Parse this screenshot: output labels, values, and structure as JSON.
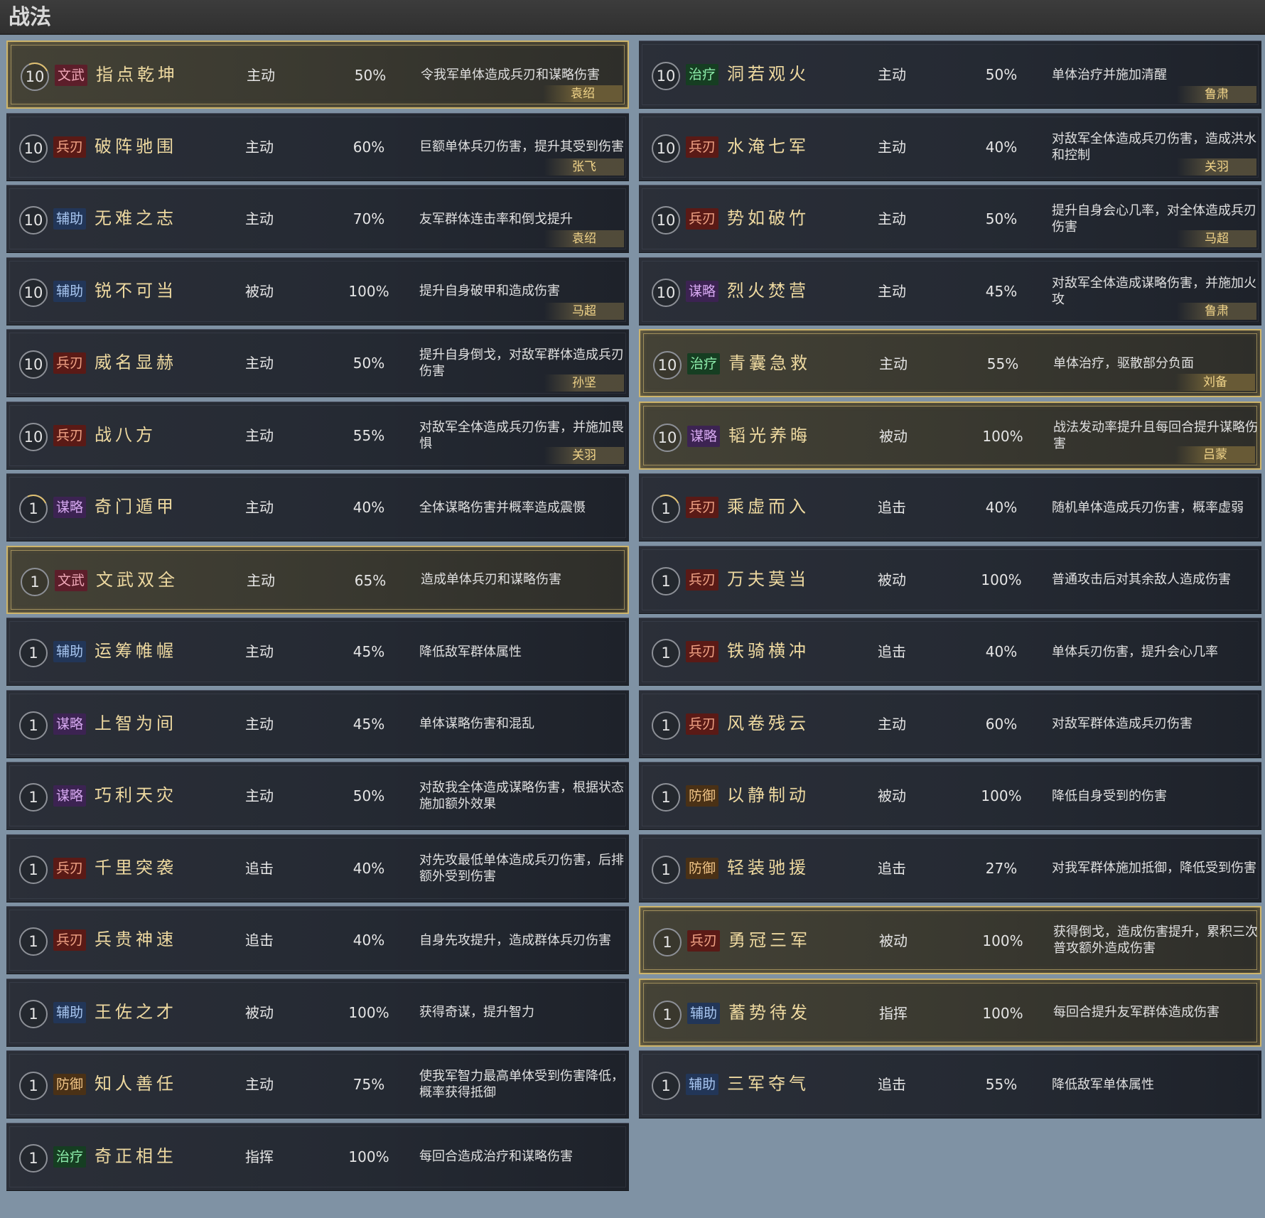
{
  "title": "战法",
  "columns": [
    [
      {
        "level": "10",
        "arc": true,
        "tag": "文武",
        "tag_class": "wenwu",
        "name": "指点乾坤",
        "type": "主动",
        "rate": "50%",
        "desc": "令我军单体造成兵刃和谋略伤害",
        "general": "袁绍",
        "highlight": true
      },
      {
        "level": "10",
        "arc": false,
        "tag": "兵刃",
        "tag_class": "bingren",
        "name": "破阵驰围",
        "type": "主动",
        "rate": "60%",
        "desc": "巨额单体兵刃伤害，提升其受到伤害",
        "general": "张飞",
        "highlight": false
      },
      {
        "level": "10",
        "arc": false,
        "tag": "辅助",
        "tag_class": "fuzhu",
        "name": "无难之志",
        "type": "主动",
        "rate": "70%",
        "desc": "友军群体连击率和倒戈提升",
        "general": "袁绍",
        "highlight": false
      },
      {
        "level": "10",
        "arc": false,
        "tag": "辅助",
        "tag_class": "fuzhu",
        "name": "锐不可当",
        "type": "被动",
        "rate": "100%",
        "desc": "提升自身破甲和造成伤害",
        "general": "马超",
        "highlight": false
      },
      {
        "level": "10",
        "arc": false,
        "tag": "兵刃",
        "tag_class": "bingren",
        "name": "威名显赫",
        "type": "主动",
        "rate": "50%",
        "desc": "提升自身倒戈，对敌军群体造成兵刃伤害",
        "general": "孙坚",
        "highlight": false
      },
      {
        "level": "10",
        "arc": false,
        "tag": "兵刃",
        "tag_class": "bingren",
        "name": "战八方",
        "type": "主动",
        "rate": "55%",
        "desc": "对敌军全体造成兵刃伤害，并施加畏惧",
        "general": "关羽",
        "highlight": false
      },
      {
        "level": "1",
        "arc": true,
        "tag": "谋略",
        "tag_class": "moulue",
        "name": "奇门遁甲",
        "type": "主动",
        "rate": "40%",
        "desc": "全体谋略伤害并概率造成震慑",
        "general": "",
        "highlight": false
      },
      {
        "level": "1",
        "arc": false,
        "tag": "文武",
        "tag_class": "wenwu",
        "name": "文武双全",
        "type": "主动",
        "rate": "65%",
        "desc": "造成单体兵刃和谋略伤害",
        "general": "",
        "highlight": true
      },
      {
        "level": "1",
        "arc": false,
        "tag": "辅助",
        "tag_class": "fuzhu",
        "name": "运筹帷幄",
        "type": "主动",
        "rate": "45%",
        "desc": "降低敌军群体属性",
        "general": "",
        "highlight": false
      },
      {
        "level": "1",
        "arc": false,
        "tag": "谋略",
        "tag_class": "moulue",
        "name": "上智为间",
        "type": "主动",
        "rate": "45%",
        "desc": "单体谋略伤害和混乱",
        "general": "",
        "highlight": false
      },
      {
        "level": "1",
        "arc": false,
        "tag": "谋略",
        "tag_class": "moulue",
        "name": "巧利天灾",
        "type": "主动",
        "rate": "50%",
        "desc": "对敌我全体造成谋略伤害，根据状态施加额外效果",
        "general": "",
        "highlight": false
      },
      {
        "level": "1",
        "arc": false,
        "tag": "兵刃",
        "tag_class": "bingren",
        "name": "千里突袭",
        "type": "追击",
        "rate": "40%",
        "desc": "对先攻最低单体造成兵刃伤害，后排额外受到伤害",
        "general": "",
        "highlight": false
      },
      {
        "level": "1",
        "arc": false,
        "tag": "兵刃",
        "tag_class": "bingren",
        "name": "兵贵神速",
        "type": "追击",
        "rate": "40%",
        "desc": "自身先攻提升，造成群体兵刃伤害",
        "general": "",
        "highlight": false
      },
      {
        "level": "1",
        "arc": false,
        "tag": "辅助",
        "tag_class": "fuzhu",
        "name": "王佐之才",
        "type": "被动",
        "rate": "100%",
        "desc": "获得奇谋，提升智力",
        "general": "",
        "highlight": false
      },
      {
        "level": "1",
        "arc": false,
        "tag": "防御",
        "tag_class": "fangyu",
        "name": "知人善任",
        "type": "主动",
        "rate": "75%",
        "desc": "使我军智力最高单体受到伤害降低，概率获得抵御",
        "general": "",
        "highlight": false
      },
      {
        "level": "1",
        "arc": false,
        "tag": "治疗",
        "tag_class": "zhiliao",
        "name": "奇正相生",
        "type": "指挥",
        "rate": "100%",
        "desc": "每回合造成治疗和谋略伤害",
        "general": "",
        "highlight": false
      }
    ],
    [
      {
        "level": "10",
        "arc": false,
        "tag": "治疗",
        "tag_class": "zhiliao",
        "name": "洞若观火",
        "type": "主动",
        "rate": "50%",
        "desc": "单体治疗并施加清醒",
        "general": "鲁肃",
        "highlight": false
      },
      {
        "level": "10",
        "arc": false,
        "tag": "兵刃",
        "tag_class": "bingren",
        "name": "水淹七军",
        "type": "主动",
        "rate": "40%",
        "desc": "对敌军全体造成兵刃伤害，造成洪水和控制",
        "general": "关羽",
        "highlight": false
      },
      {
        "level": "10",
        "arc": false,
        "tag": "兵刃",
        "tag_class": "bingren",
        "name": "势如破竹",
        "type": "主动",
        "rate": "50%",
        "desc": "提升自身会心几率，对全体造成兵刃伤害",
        "general": "马超",
        "highlight": false
      },
      {
        "level": "10",
        "arc": false,
        "tag": "谋略",
        "tag_class": "moulue",
        "name": "烈火焚营",
        "type": "主动",
        "rate": "45%",
        "desc": "对敌军全体造成谋略伤害，并施加火攻",
        "general": "鲁肃",
        "highlight": false
      },
      {
        "level": "10",
        "arc": false,
        "tag": "治疗",
        "tag_class": "zhiliao",
        "name": "青囊急救",
        "type": "主动",
        "rate": "55%",
        "desc": "单体治疗，驱散部分负面",
        "general": "刘备",
        "highlight": true
      },
      {
        "level": "10",
        "arc": false,
        "tag": "谋略",
        "tag_class": "moulue",
        "name": "韬光养晦",
        "type": "被动",
        "rate": "100%",
        "desc": "战法发动率提升且每回合提升谋略伤害",
        "general": "吕蒙",
        "highlight": true
      },
      {
        "level": "1",
        "arc": true,
        "tag": "兵刃",
        "tag_class": "bingren",
        "name": "乘虚而入",
        "type": "追击",
        "rate": "40%",
        "desc": "随机单体造成兵刃伤害，概率虚弱",
        "general": "",
        "highlight": false
      },
      {
        "level": "1",
        "arc": false,
        "tag": "兵刃",
        "tag_class": "bingren",
        "name": "万夫莫当",
        "type": "被动",
        "rate": "100%",
        "desc": "普通攻击后对其余敌人造成伤害",
        "general": "",
        "highlight": false
      },
      {
        "level": "1",
        "arc": false,
        "tag": "兵刃",
        "tag_class": "bingren",
        "name": "铁骑横冲",
        "type": "追击",
        "rate": "40%",
        "desc": "单体兵刃伤害，提升会心几率",
        "general": "",
        "highlight": false
      },
      {
        "level": "1",
        "arc": false,
        "tag": "兵刃",
        "tag_class": "bingren",
        "name": "风卷残云",
        "type": "主动",
        "rate": "60%",
        "desc": "对敌军群体造成兵刃伤害",
        "general": "",
        "highlight": false
      },
      {
        "level": "1",
        "arc": false,
        "tag": "防御",
        "tag_class": "fangyu",
        "name": "以静制动",
        "type": "被动",
        "rate": "100%",
        "desc": "降低自身受到的伤害",
        "general": "",
        "highlight": false
      },
      {
        "level": "1",
        "arc": false,
        "tag": "防御",
        "tag_class": "fangyu",
        "name": "轻装驰援",
        "type": "追击",
        "rate": "27%",
        "desc": "对我军群体施加抵御，降低受到伤害",
        "general": "",
        "highlight": false
      },
      {
        "level": "1",
        "arc": false,
        "tag": "兵刃",
        "tag_class": "bingren",
        "name": "勇冠三军",
        "type": "被动",
        "rate": "100%",
        "desc": "获得倒戈，造成伤害提升，累积三次普攻额外造成伤害",
        "general": "",
        "highlight": true
      },
      {
        "level": "1",
        "arc": false,
        "tag": "辅助",
        "tag_class": "fuzhu",
        "name": "蓄势待发",
        "type": "指挥",
        "rate": "100%",
        "desc": "每回合提升友军群体造成伤害",
        "general": "",
        "highlight": true
      },
      {
        "level": "1",
        "arc": false,
        "tag": "辅助",
        "tag_class": "fuzhu",
        "name": "三军夺气",
        "type": "追击",
        "rate": "55%",
        "desc": "降低敌军单体属性",
        "general": "",
        "highlight": false
      }
    ]
  ]
}
